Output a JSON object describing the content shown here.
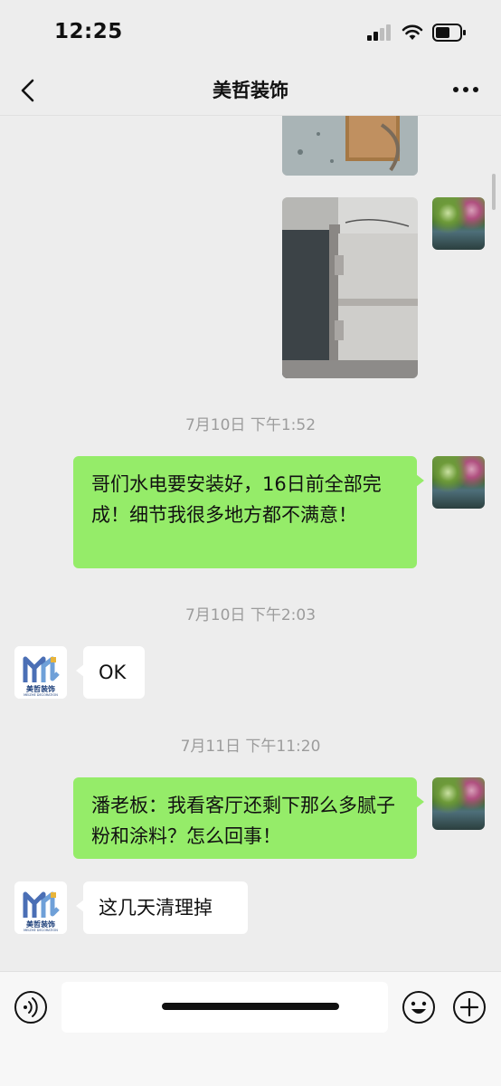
{
  "status_bar": {
    "time": "12:25"
  },
  "nav": {
    "title": "美哲装饰"
  },
  "messages": [
    {
      "type": "image",
      "sender": "me"
    },
    {
      "type": "image",
      "sender": "me"
    },
    {
      "type": "timestamp",
      "text": "7月10日 下午1:52"
    },
    {
      "type": "text",
      "sender": "me",
      "text": "哥们水电要安装好，16日前全部完成！细节我很多地方都不满意！"
    },
    {
      "type": "timestamp",
      "text": "7月10日 下午2:03"
    },
    {
      "type": "text",
      "sender": "company",
      "text": "OK"
    },
    {
      "type": "timestamp",
      "text": "7月11日 下午11:20"
    },
    {
      "type": "text",
      "sender": "me",
      "text": "潘老板：我看客厅还剩下那么多腻子粉和涂料？怎么回事！"
    },
    {
      "type": "text",
      "sender": "company",
      "text": "这几天清理掉"
    }
  ],
  "company_logo": {
    "name": "美哲装饰",
    "subtitle": "MEIZHE DECORATION"
  },
  "input": {
    "value": ""
  },
  "icons": {
    "back": "chevron-left-icon",
    "more": "more-icon",
    "voice": "voice-icon",
    "emoji": "emoji-icon",
    "add": "plus-icon"
  },
  "colors": {
    "outgoing_bubble": "#95ec69",
    "incoming_bubble": "#ffffff",
    "background": "#ededed",
    "timestamp": "#9c9c9c"
  }
}
